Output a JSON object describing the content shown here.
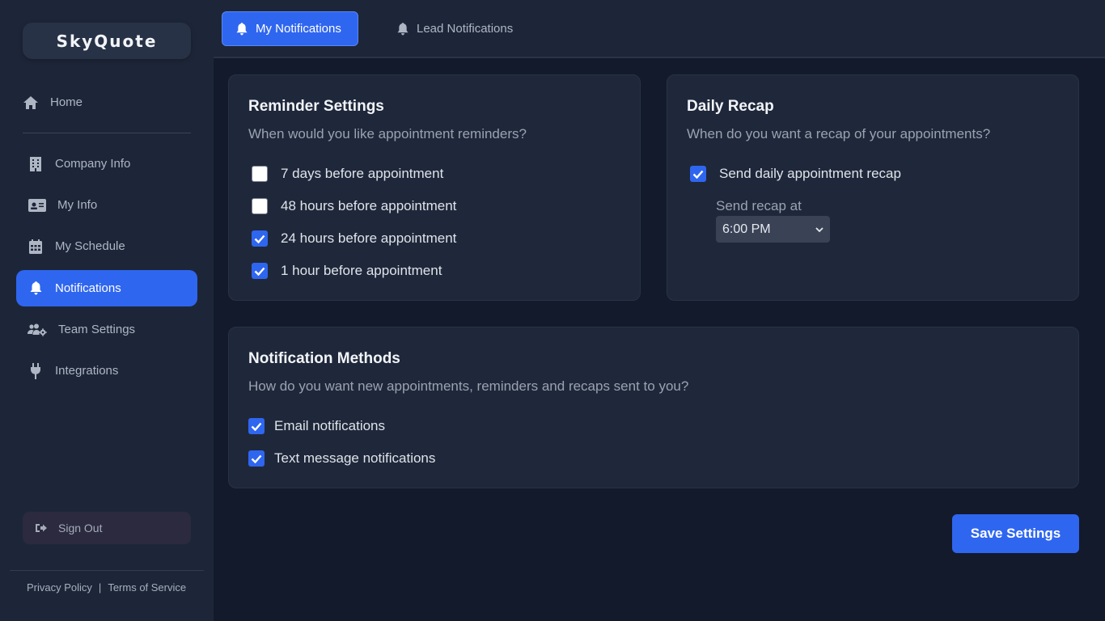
{
  "app": {
    "brand": "SkyQuote"
  },
  "sidebar": {
    "items": [
      {
        "label": "Home",
        "icon": "home-icon"
      },
      {
        "label": "Company Info",
        "icon": "building-icon"
      },
      {
        "label": "My Info",
        "icon": "id-card-icon"
      },
      {
        "label": "My Schedule",
        "icon": "calendar-icon"
      },
      {
        "label": "Notifications",
        "icon": "bell-icon",
        "active": true
      },
      {
        "label": "Team Settings",
        "icon": "team-gear-icon"
      },
      {
        "label": "Integrations",
        "icon": "plug-icon"
      }
    ],
    "sign_out": "Sign Out",
    "footer": {
      "privacy": "Privacy Policy",
      "separator": "|",
      "terms": "Terms of Service"
    }
  },
  "tabs": [
    {
      "label": "My Notifications",
      "active": true
    },
    {
      "label": "Lead Notifications",
      "active": false
    }
  ],
  "reminder": {
    "title": "Reminder Settings",
    "subtitle": "When would you like appointment reminders?",
    "options": [
      {
        "label": "7 days before appointment",
        "checked": false
      },
      {
        "label": "48 hours before appointment",
        "checked": false
      },
      {
        "label": "24 hours before appointment",
        "checked": true
      },
      {
        "label": "1 hour before appointment",
        "checked": true
      }
    ]
  },
  "recap": {
    "title": "Daily Recap",
    "subtitle": "When do you want a recap of your appointments?",
    "option": {
      "label": "Send daily appointment recap",
      "checked": true
    },
    "time_label": "Send recap at",
    "time_value": "6:00 PM"
  },
  "methods": {
    "title": "Notification Methods",
    "subtitle": "How do you want new appointments, reminders and recaps sent to you?",
    "options": [
      {
        "label": "Email notifications",
        "checked": true
      },
      {
        "label": "Text message notifications",
        "checked": true
      }
    ]
  },
  "save_label": "Save Settings",
  "colors": {
    "accent": "#2f66f0",
    "background": "#131a2b",
    "sidebar": "#1d2638",
    "card": "#1f283a"
  }
}
